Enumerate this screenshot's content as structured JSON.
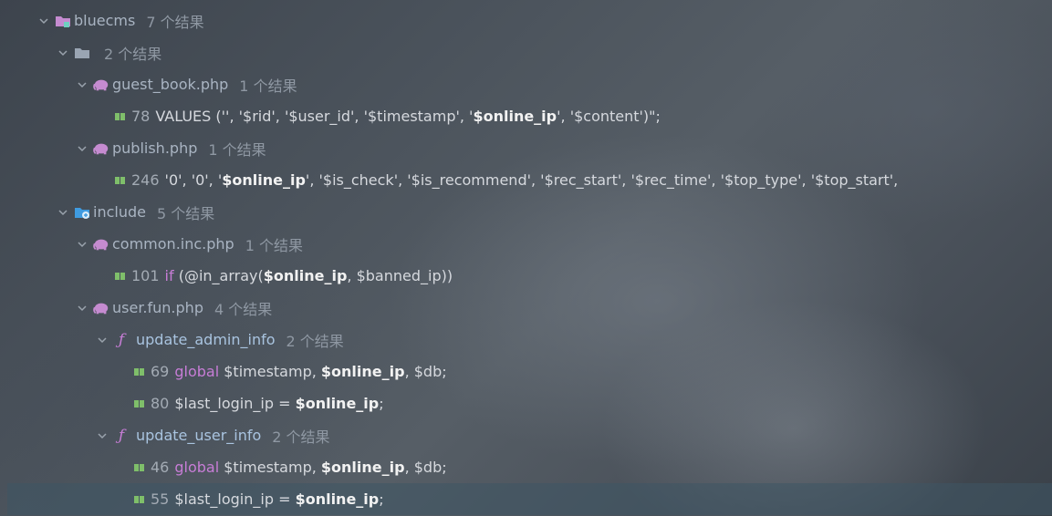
{
  "tree": {
    "root": {
      "name": "bluecms",
      "count": "7 个结果"
    },
    "folder_blank": {
      "name": "",
      "count": "2 个结果"
    },
    "guest_book": {
      "name": "guest_book.php",
      "count": "1 个结果",
      "line": {
        "no": "78",
        "p1": "VALUES ('', '$rid', '$user_id', '$timestamp', '",
        "match": "$online_ip",
        "p2": "', '$content')\";"
      }
    },
    "publish": {
      "name": "publish.php",
      "count": "1 个结果",
      "line": {
        "no": "246",
        "p1": " '0', '0', '",
        "match": "$online_ip",
        "p2": "', '$is_check', '$is_recommend', '$rec_start', '$rec_time', '$top_type', '$top_start',"
      }
    },
    "include": {
      "name": "include",
      "count": "5 个结果"
    },
    "common_inc": {
      "name": "common.inc.php",
      "count": "1 个结果",
      "line": {
        "no": "101",
        "kw": "if",
        "p1": " (@in_array(",
        "match": "$online_ip",
        "p2": ", $banned_ip))"
      }
    },
    "user_fun": {
      "name": "user.fun.php",
      "count": "4 个结果"
    },
    "update_admin_info": {
      "name": "update_admin_info",
      "count": "2 个结果",
      "line1": {
        "no": "69",
        "kw": "global",
        "p1": " $timestamp, ",
        "match": "$online_ip",
        "p2": ", $db;"
      },
      "line2": {
        "no": "80",
        "p1": "$last_login_ip = ",
        "match": "$online_ip",
        "p2": ";"
      }
    },
    "update_user_info": {
      "name": "update_user_info",
      "count": "2 个结果",
      "line1": {
        "no": "46",
        "kw": "global",
        "p1": " $timestamp, ",
        "match": "$online_ip",
        "p2": ", $db;"
      },
      "line2": {
        "no": "55",
        "p1": "$last_login_ip = ",
        "match": "$online_ip",
        "p2": ";"
      }
    }
  },
  "colors": {
    "keyword": "#c77dd6",
    "php_icon": "#c58bd0",
    "folder_icon": "#9aa5b3",
    "include_icon": "#3f9be0",
    "book_icon": "#7fbf6a",
    "selection": "#3e5664"
  },
  "icons": {
    "chevron": "chevron-down-icon",
    "project": "project-folder-icon",
    "folder": "folder-icon",
    "include": "include-folder-icon",
    "php": "php-elephant-icon",
    "function": "function-icon",
    "usage": "usage-line-icon"
  }
}
